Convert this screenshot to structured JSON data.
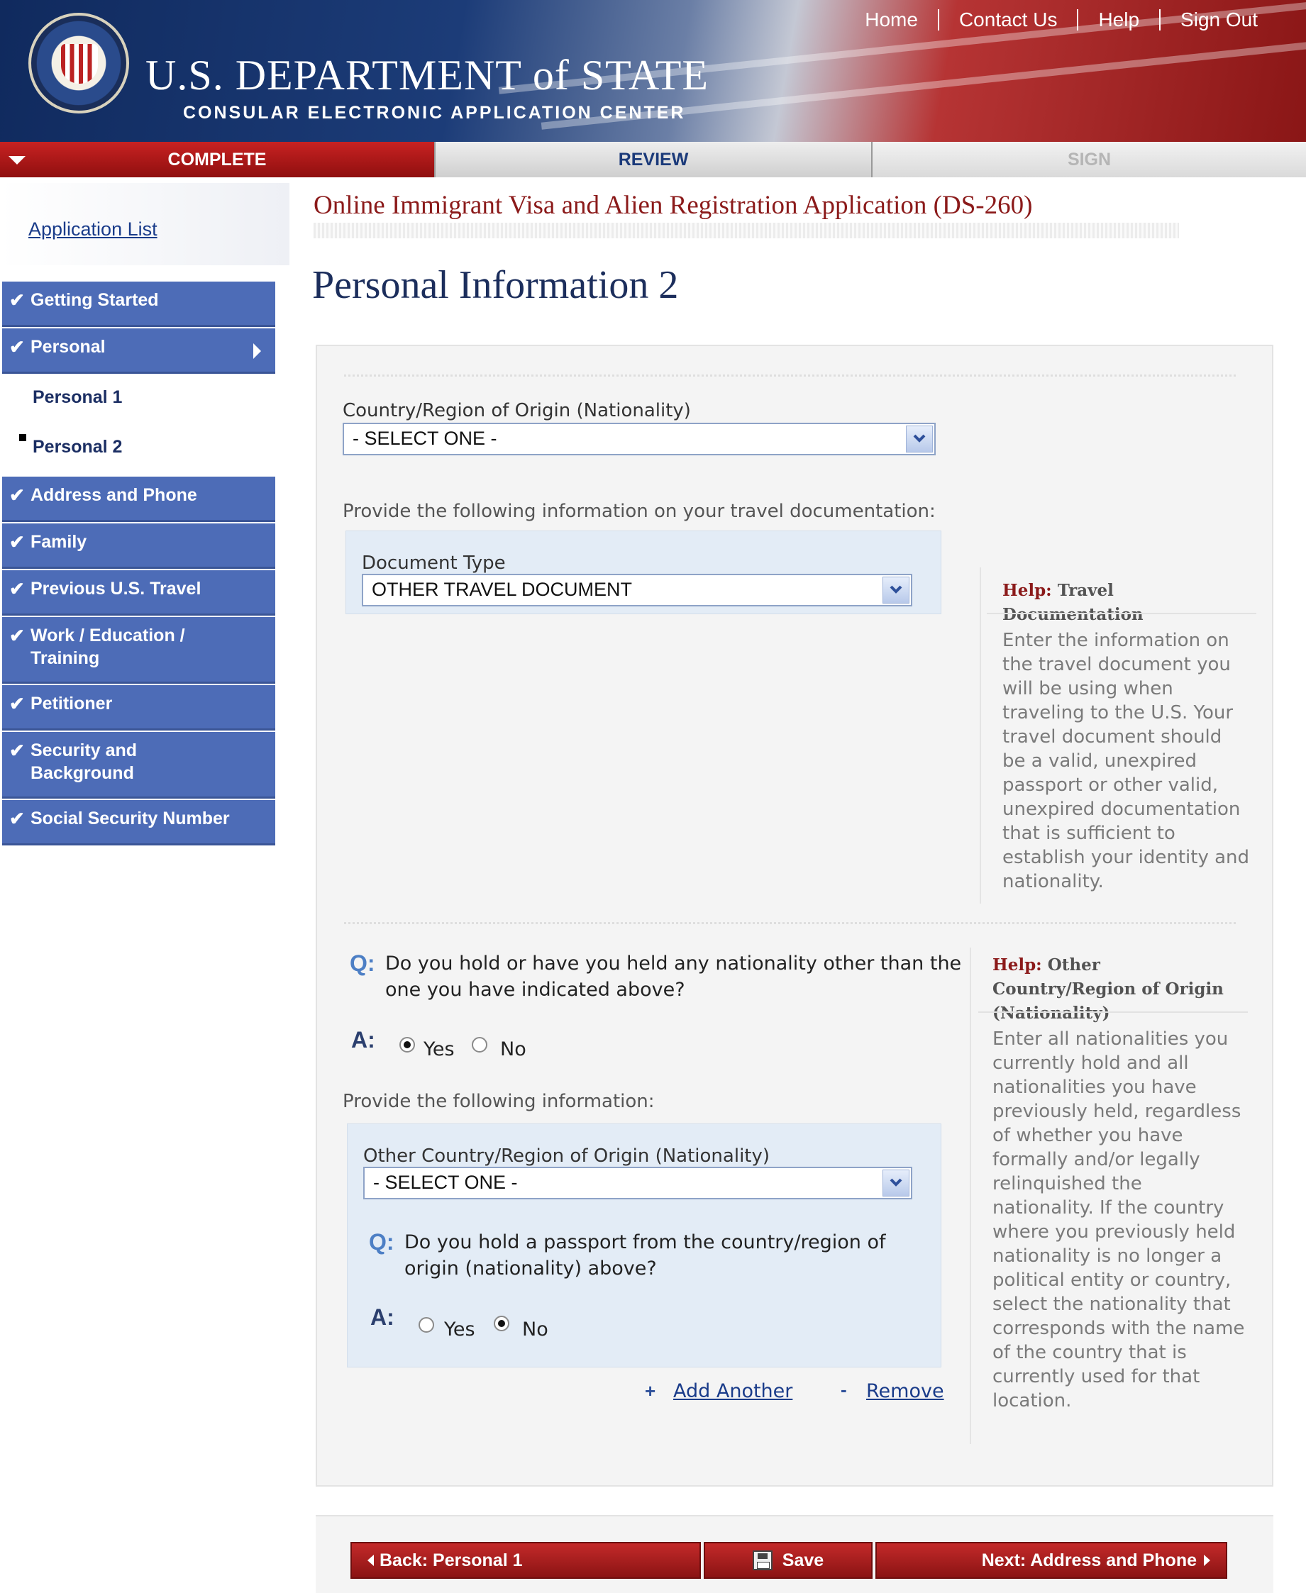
{
  "header": {
    "dept_title": "U.S. DEPARTMENT of STATE",
    "dept_subtitle": "CONSULAR ELECTRONIC APPLICATION CENTER",
    "nav": {
      "home": "Home",
      "contact": "Contact Us",
      "help": "Help",
      "signout": "Sign Out"
    }
  },
  "progress": {
    "complete": "COMPLETE",
    "review": "REVIEW",
    "sign": "SIGN"
  },
  "sidebar": {
    "app_list": "Application List",
    "items": {
      "getting_started": "Getting Started",
      "personal": "Personal",
      "personal1": "Personal 1",
      "personal2": "Personal 2",
      "address": "Address and Phone",
      "family": "Family",
      "prev_travel": "Previous U.S. Travel",
      "work_edu": "Work / Education / Training",
      "petitioner": "Petitioner",
      "security": "Security and Background",
      "ssn": "Social Security Number"
    },
    "check_glyph": "✔"
  },
  "main": {
    "app_title": "Online Immigrant Visa and Alien Registration Application (DS-260)",
    "page_title": "Personal Information 2",
    "nationality_label": "Country/Region of Origin (Nationality)",
    "nationality_value": "- SELECT ONE -",
    "travel_doc_intro": "Provide the following information on your travel documentation:",
    "doc_type_label": "Document Type",
    "doc_type_value": "OTHER TRAVEL DOCUMENT",
    "help1": {
      "prefix": "Help:",
      "title": "Travel Documentation",
      "text": "Enter the information on the travel document you will be using when traveling to the U.S. Your travel document should be a valid, unexpired passport or other valid, unexpired documentation that is sufficient to establish your identity and nationality."
    },
    "q1": {
      "q_mark": "Q:",
      "text": "Do you hold or have you held any nationality other than the one you have indicated above?",
      "a_mark": "A:",
      "yes": "Yes",
      "no": "No",
      "selected": "yes"
    },
    "provide_info": "Provide the following information:",
    "other_nat_label": "Other Country/Region of Origin (Nationality)",
    "other_nat_value": "- SELECT ONE -",
    "q2": {
      "q_mark": "Q:",
      "text": "Do you hold a passport from the country/region of origin (nationality) above?",
      "a_mark": "A:",
      "yes": "Yes",
      "no": "No",
      "selected": "no"
    },
    "add_another": "Add Another",
    "remove": "Remove",
    "plus_glyph": "+",
    "minus_glyph": "-",
    "help2": {
      "prefix": "Help:",
      "title": "Other Country/Region of Origin (Nationality)",
      "text": "Enter all nationalities you currently hold and all nationalities you have previously held, regardless of whether you have formally and/or legally relinquished the nationality. If the country where you previously held nationality is no longer a political entity or country, select the nationality that corresponds with the name of the country that is currently used for that location."
    }
  },
  "buttons": {
    "back": "Back: Personal 1",
    "save": "Save",
    "next": "Next: Address and Phone"
  }
}
